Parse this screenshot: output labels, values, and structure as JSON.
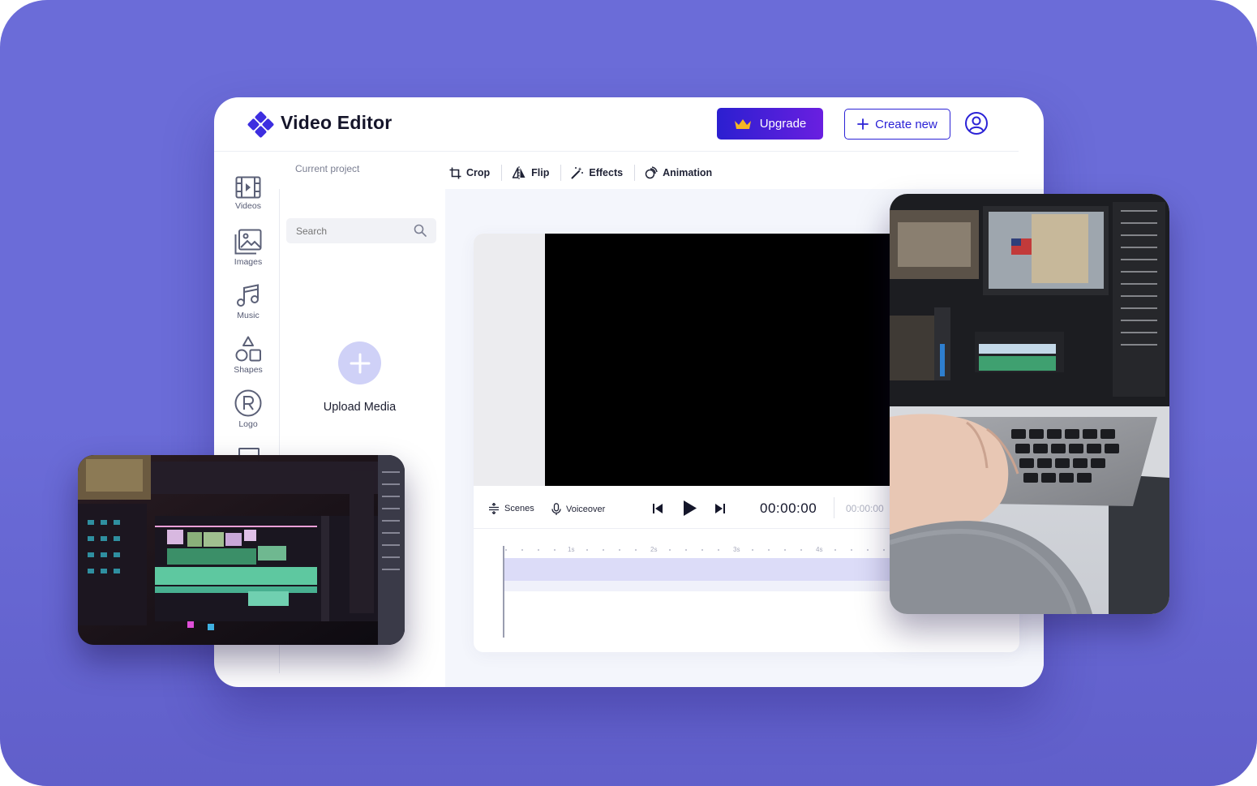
{
  "app": {
    "title": "Video Editor"
  },
  "header": {
    "upgrade_label": "Upgrade",
    "create_label": "Create new"
  },
  "nav": {
    "items": [
      {
        "label": "Videos",
        "icon": "film-icon"
      },
      {
        "label": "Images",
        "icon": "image-icon"
      },
      {
        "label": "Music",
        "icon": "music-icon"
      },
      {
        "label": "Shapes",
        "icon": "shapes-icon"
      },
      {
        "label": "Logo",
        "icon": "registered-icon"
      }
    ]
  },
  "project": {
    "label": "Current project"
  },
  "toolbar": {
    "crop": "Crop",
    "flip": "Flip",
    "effects": "Effects",
    "animation": "Animation"
  },
  "media_panel": {
    "search_placeholder": "Search",
    "upload_label": "Upload Media"
  },
  "player": {
    "scenes_label": "Scenes",
    "voiceover_label": "Voiceover",
    "current_time": "00:00:00",
    "total_time": "00:00:00"
  },
  "timeline": {
    "ticks": [
      "1s",
      "2s",
      "3s",
      "4s"
    ]
  },
  "colors": {
    "background": "#6b6cd8",
    "accent": "#2b22d6",
    "upgrade_gradient_end": "#6a1fe0",
    "crown": "#f5b623"
  }
}
